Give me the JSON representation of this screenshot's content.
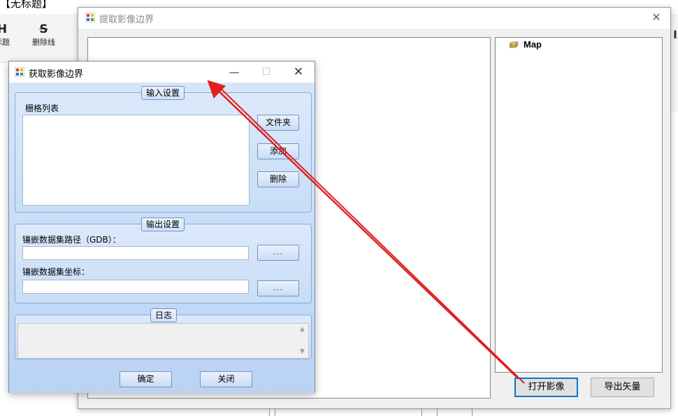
{
  "background_app": {
    "title": "【无标题】",
    "ribbon": {
      "heading_button_label": "标题",
      "heading_glyph": "H",
      "strikethrough_button_label": "删除线",
      "strikethrough_glyph": "S"
    }
  },
  "main_window": {
    "title": "提取影像边界",
    "close_symbol": "✕",
    "tree": {
      "layer_label": "Map"
    },
    "open_image_button": "打开影像",
    "export_vector_button": "导出矢量"
  },
  "dialog": {
    "title": "获取影像边界",
    "minimize_symbol": "—",
    "maximize_symbol": "☐",
    "close_symbol": "✕",
    "input_group": {
      "label": "输入设置",
      "raster_list_label": "栅格列表",
      "folder_button": "文件夹",
      "add_button": "添加",
      "delete_button": "删除"
    },
    "output_group": {
      "label": "输出设置",
      "gdb_path_label": "镶嵌数据集路径（GDB）：",
      "gdb_path_value": "",
      "gdb_browse_button": "...",
      "coord_label": "镶嵌数据集坐标：",
      "coord_value": "",
      "coord_browse_button": "..."
    },
    "log_group": {
      "label": "日志"
    },
    "ok_button": "确定",
    "close_button": "关闭"
  },
  "colors": {
    "arrow": "#e0201e",
    "dialog_bg": "#c4dbf6",
    "focus_border": "#0078d7"
  }
}
